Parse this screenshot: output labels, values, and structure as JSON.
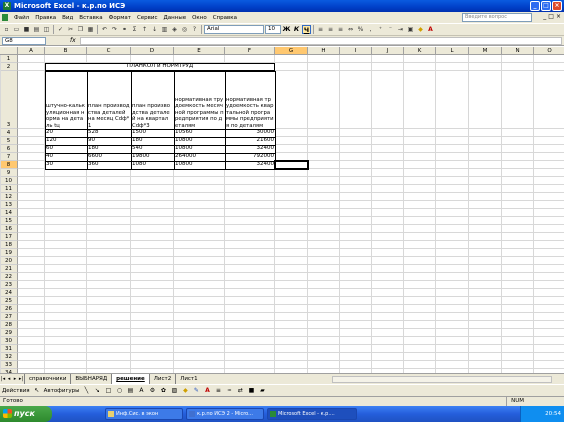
{
  "window": {
    "title": "Microsoft Excel - к.р.по ИСЭ"
  },
  "menu": {
    "items": [
      "Файл",
      "Правка",
      "Вид",
      "Вставка",
      "Формат",
      "Сервис",
      "Данные",
      "Окно",
      "Справка"
    ],
    "help_placeholder": "Введите вопрос"
  },
  "toolbar": {
    "font": "Arial",
    "size": "10",
    "bold": "Ж",
    "italic": "К",
    "underline": "Ч"
  },
  "formula_bar": {
    "name_box": "G8",
    "fx": "fx",
    "value": ""
  },
  "columns": [
    "A",
    "B",
    "C",
    "D",
    "E",
    "F",
    "G",
    "H",
    "I",
    "J",
    "K",
    "L",
    "M",
    "N",
    "O"
  ],
  "rows": [
    "1",
    "2",
    "3",
    "4",
    "5",
    "6",
    "7",
    "8",
    "9",
    "10",
    "11",
    "12",
    "13",
    "14",
    "15",
    "16",
    "17",
    "18",
    "19",
    "20",
    "21",
    "22",
    "23",
    "24",
    "25",
    "26",
    "27",
    "28",
    "29",
    "30",
    "31",
    "32",
    "33",
    "34",
    "35",
    "36",
    "37",
    "38"
  ],
  "sheet": {
    "title": "ПЛАНКОЛ и НОРМТРУД",
    "headers": [
      "штучно-калькуляционная норма на деталь tц",
      "план производства деталей на месяц Cdф*1",
      "план производства деталей на квартал Cdф*3",
      "нормативная трудоемкость месячной программы предприятия по деталям",
      "нормативная трудоемкость квартальной программы предприятия по деталям"
    ],
    "data": [
      [
        "20",
        "528",
        "1500",
        "10560",
        "30000"
      ],
      [
        "120",
        "90",
        "180",
        "10800",
        "21600"
      ],
      [
        "60",
        "180",
        "540",
        "10800",
        "32400"
      ],
      [
        "40",
        "6600",
        "19800",
        "264000",
        "792000"
      ],
      [
        "30",
        "360",
        "1080",
        "10800",
        "32400"
      ]
    ]
  },
  "sheet_tabs": [
    "справочники",
    "ВЫБНАРЯД",
    "решение",
    "Лист2",
    "Лист1"
  ],
  "active_tab": "решение",
  "draw_toolbar": {
    "actions": "Действия",
    "autoshapes": "Автофигуры"
  },
  "status": {
    "left": "Готово",
    "num": "NUM"
  },
  "taskbar": {
    "start": "пуск",
    "tasks": [
      "Инф.Сис. в экон",
      "к.р.по ИСЭ 2 - Micro...",
      "Microsoft Excel - к.р...."
    ],
    "clock": "20:54"
  }
}
